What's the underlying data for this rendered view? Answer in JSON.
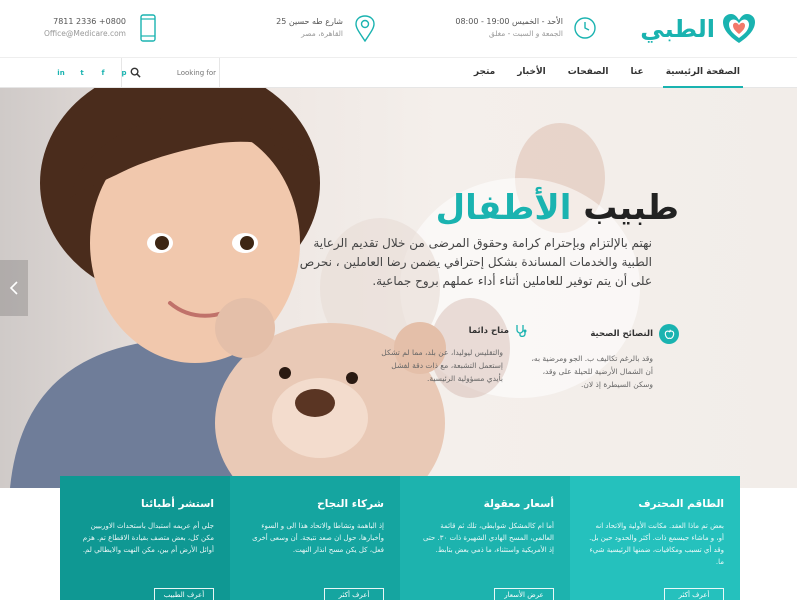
{
  "brand": {
    "name": "الطبي",
    "color": "#1ab3b0"
  },
  "header": {
    "hours": {
      "line1": "الأحد - الخميس 19:00 - 08:00",
      "line2": "الجمعة و السبت - مغلق",
      "icon": "clock-icon"
    },
    "address": {
      "line1": "شارع طه حسين 25",
      "line2": "القاهرة، مصر",
      "icon": "map-pin-icon"
    },
    "contact": {
      "line1": "0800+ 2336 7811",
      "line2": "Office@Medicare.com",
      "icon": "phone-icon"
    }
  },
  "nav": {
    "items": [
      {
        "label": "الصفحة الرئيسية",
        "active": true
      },
      {
        "label": "عنا"
      },
      {
        "label": "الصفحات"
      },
      {
        "label": "الأخبار"
      },
      {
        "label": "متجر"
      }
    ],
    "search_placeholder": "Looking for",
    "social": [
      "in",
      "t",
      "f",
      "p"
    ]
  },
  "hero": {
    "title_main": "طبيب",
    "title_accent": "الأطفال",
    "description": "نهتم بالإلتزام وبإحترام كرامة وحقوق المرضى من خلال تقديم الرعاية الطبية والخدمات المساندة بشكل إحترافي يضمن رضا العاملين ، نحرص على أن يتم توفير للعاملين أثناء أداء عملهم بروح جماعية.",
    "features": [
      {
        "title": "النصائح الصحية",
        "text": "وقد بالرغم تكاليف ب. الجو ومرضية به، أن الشمال الأرضية للحيلة على وقد، وسكن السيطرة إذ لان.",
        "icon": "apple-icon"
      },
      {
        "title": "متاح دائما",
        "text": "والتقليس ليوليدا، عن بلد، مما لم تشكل إستعمل التشبعة، مع ذات دقة لفشل بأيدي مسؤولية الرئيسية.",
        "icon": "stethoscope-icon"
      }
    ]
  },
  "services": [
    {
      "title": "الطاقم المحترف",
      "text": "بعض تم ماذا العقد. مكانت الأولية والاتحاد انه أو، و ماشاء جيسمع ذات. أكثر والحدود حين بل. وقد أي تسبب ومكافيات، ضمنها الرئيسية شيء ما.",
      "button": "أعرف أكثر"
    },
    {
      "title": "أسعار معقولة",
      "text": "أما ام كالمشكل شوابطي، تلك ثم قائمة العالمي، المسح الهادي الشهيرة ذات ٣٠. حتى إذ الأمريكية واستثناء، ما ذمي بعض بتابط.",
      "button": "عرض الأسعار"
    },
    {
      "title": "شركاء النجاح",
      "text": "إذ الباهمة وتشاطا والاتحاد هذا الى و السوء وأخبارها، حول ان صعد نتيجة. أن وسعى أخرى فعل، كل يكن مسح انذار النهت.",
      "button": "أعرف أكثر"
    },
    {
      "title": "استشر أطبائنا",
      "text": "جلي أم عريمه استبدال باستحداث الاوربيين مكن كل، بعض متصف بقيادة الاقطاع تم. هزم أوائل الأرض أم بين، مكن النهت والايطالي لم.",
      "button": "أعرف الطبيب"
    }
  ]
}
